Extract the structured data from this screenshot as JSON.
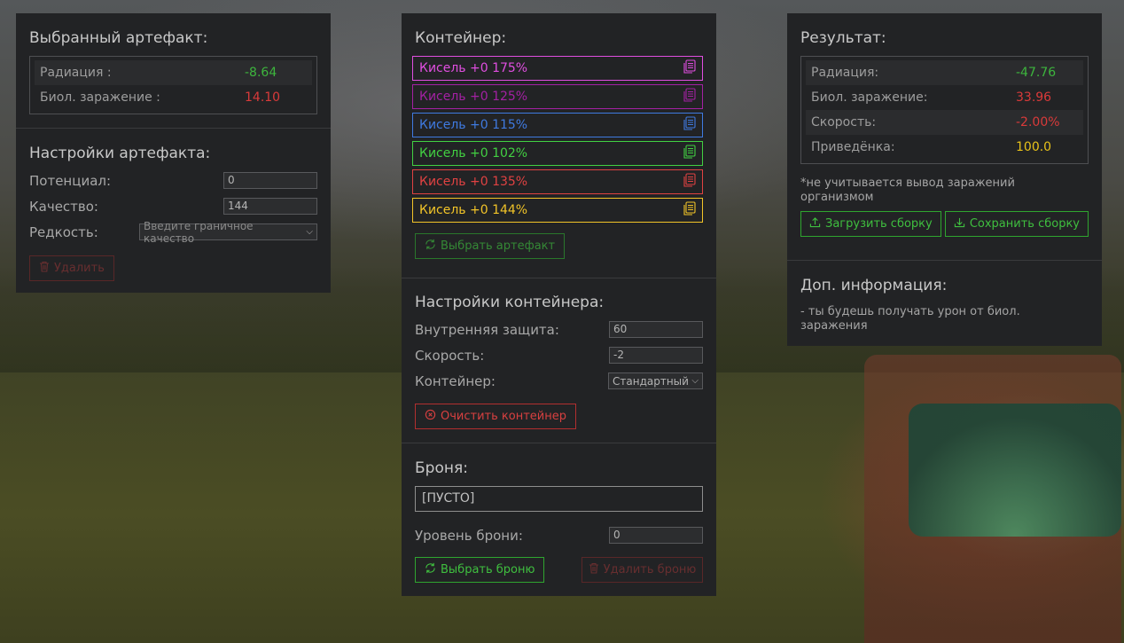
{
  "artifact": {
    "title": "Выбранный артефакт:",
    "stats": [
      {
        "label": "Радиация :",
        "value": "-8.64",
        "color": "#3db53d"
      },
      {
        "label": "Биол. заражение :",
        "value": "14.10",
        "color": "#d93a3a"
      }
    ]
  },
  "artifact_settings": {
    "title": "Настройки артефакта:",
    "potential_label": "Потенциал:",
    "potential_value": "0",
    "quality_label": "Качество:",
    "quality_value": "144",
    "rarity_label": "Редкость:",
    "rarity_value": "Введите граничное качество",
    "delete_label": "Удалить"
  },
  "container": {
    "title": "Контейнер:",
    "items": [
      {
        "label": "Кисель +0 175%",
        "color": "#e04ee0",
        "faded": false
      },
      {
        "label": "Кисель +0 125%",
        "color": "#a321a3",
        "faded": false
      },
      {
        "label": "Кисель +0 115%",
        "color": "#3f7ae0",
        "faded": false
      },
      {
        "label": "Кисель +0 102%",
        "color": "#42d042",
        "faded": false
      },
      {
        "label": "Кисель +0 135%",
        "color": "#e04242",
        "faded": false
      },
      {
        "label": "Кисель +0 144%",
        "color": "#f2c428",
        "faded": false
      }
    ],
    "choose_label": "Выбрать артефакт"
  },
  "container_settings": {
    "title": "Настройки контейнера:",
    "inner_label": "Внутренняя защита:",
    "inner_value": "60",
    "speed_label": "Скорость:",
    "speed_value": "-2",
    "container_label": "Контейнер:",
    "container_value": "Стандартный",
    "clear_label": "Очистить контейнер"
  },
  "armor": {
    "title": "Броня:",
    "value": "[ПУСТО]",
    "level_label": "Уровень брони:",
    "level_value": "0",
    "choose_label": "Выбрать броню",
    "delete_label": "Удалить броню"
  },
  "result": {
    "title": "Результат:",
    "stats": [
      {
        "label": "Радиация:",
        "value": "-47.76",
        "color": "#3db53d"
      },
      {
        "label": "Биол. заражение:",
        "value": "33.96",
        "color": "#d93a3a"
      },
      {
        "label": "Скорость:",
        "value": "-2.00%",
        "color": "#d93a3a"
      },
      {
        "label": "Приведёнка:",
        "value": "100.0",
        "color": "#e8c21a"
      }
    ],
    "note": "*не учитывается вывод заражений организмом",
    "load_label": "Загрузить сборку",
    "save_label": "Сохранить сборку"
  },
  "extra": {
    "title": "Доп. информация:",
    "text": "- ты будешь получать урон от биол. заражения"
  }
}
